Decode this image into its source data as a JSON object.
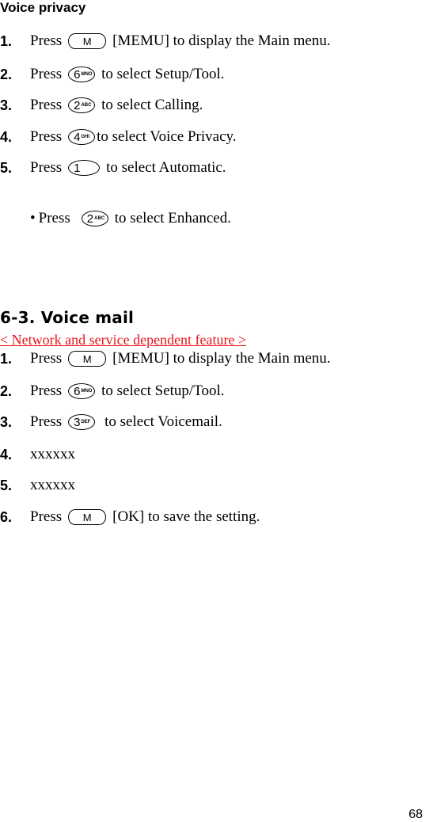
{
  "voice_privacy": {
    "title": "Voice privacy",
    "steps": [
      {
        "num": "1.",
        "pre": "Press",
        "key": "M",
        "key_sub": "",
        "post": "[MEMU] to display the Main menu."
      },
      {
        "num": "2.",
        "pre": "Press",
        "key": "6",
        "key_sub": "MNO",
        "post": "to select Setup/Tool."
      },
      {
        "num": "3.",
        "pre": "Press",
        "key": "2",
        "key_sub": "ABC",
        "post": "to select Calling."
      },
      {
        "num": "4.",
        "pre": "Press",
        "key": "4",
        "key_sub": "GHI",
        "post": "to select Voice Privacy."
      },
      {
        "num": "5.",
        "pre": "Press",
        "key": "1",
        "key_sub": "",
        "post": "to select Automatic."
      }
    ],
    "bullet": {
      "mark": "•",
      "pre": "Press",
      "key": "2",
      "key_sub": "ABC",
      "post": "to select Enhanced."
    }
  },
  "voice_mail": {
    "title": "6-3. Voice mail",
    "note": "< Network and service dependent feature >",
    "note_color": "#e8141b",
    "steps": [
      {
        "num": "1.",
        "pre": "Press",
        "key": "M",
        "key_sub": "",
        "post": "[MEMU] to display the Main menu."
      },
      {
        "num": "2.",
        "pre": "Press",
        "key": "6",
        "key_sub": "MNO",
        "post": "to select Setup/Tool."
      },
      {
        "num": "3.",
        "pre": "Press",
        "key": "3",
        "key_sub": "DEF",
        "post": "to select Voicemail."
      },
      {
        "num": "4.",
        "text": "xxxxxx"
      },
      {
        "num": "5.",
        "text": "xxxxxx"
      },
      {
        "num": "6.",
        "pre": "Press",
        "key": "M",
        "key_sub": "",
        "post": "[OK] to save the setting."
      }
    ]
  },
  "page_number": "68"
}
